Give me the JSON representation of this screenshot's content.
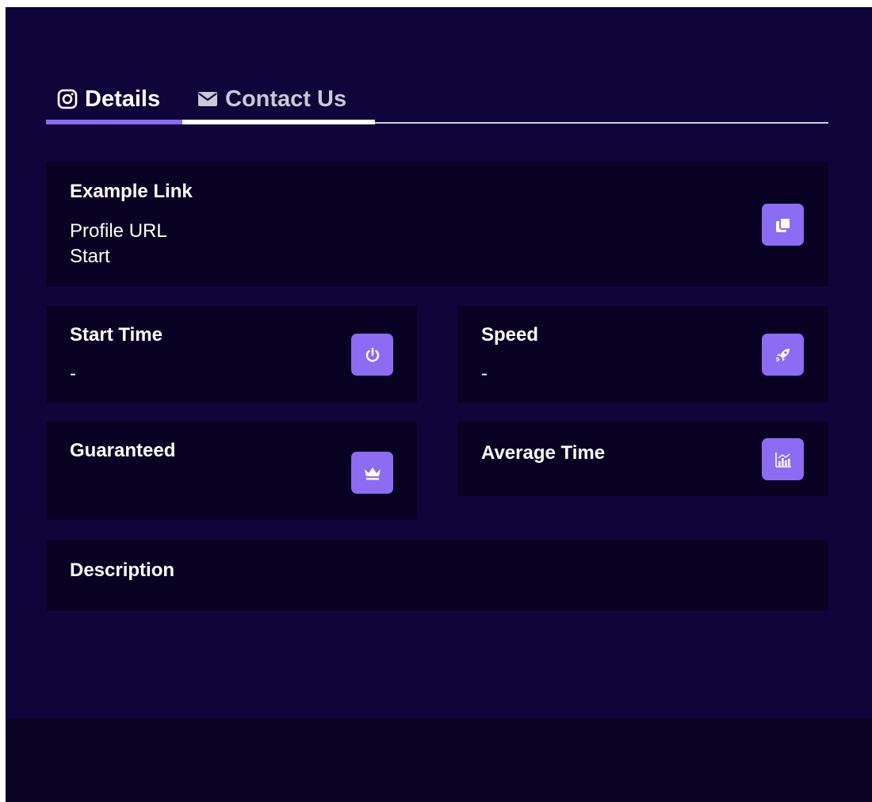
{
  "tabs": [
    {
      "label": "Details",
      "icon": "instagram-icon",
      "active": true
    },
    {
      "label": "Contact Us",
      "icon": "mail-icon",
      "active": false
    }
  ],
  "example_link": {
    "title": "Example Link",
    "line1": "Profile URL",
    "line2": "Start",
    "icon": "copy-icon"
  },
  "start_time": {
    "title": "Start Time",
    "value": "-",
    "icon": "power-icon"
  },
  "speed": {
    "title": "Speed",
    "value": "-",
    "icon": "rocket-icon"
  },
  "guaranteed": {
    "title": "Guaranteed",
    "value": "",
    "icon": "crown-icon"
  },
  "average_time": {
    "title": "Average Time",
    "value": "",
    "icon": "bar-chart-icon"
  },
  "description": {
    "title": "Description",
    "value": ""
  },
  "colors": {
    "accent": "#8b6cf2",
    "panel_background": "#10053a",
    "card_background": "#0a0222",
    "footer_background": "#0b0324",
    "text_primary": "#ffffff",
    "text_muted": "#c9c9d4"
  }
}
